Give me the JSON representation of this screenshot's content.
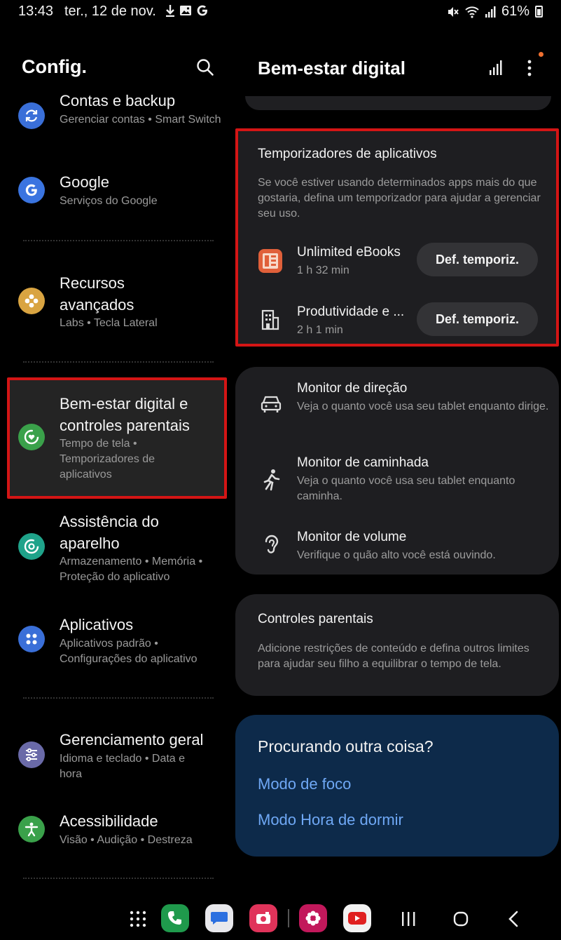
{
  "status": {
    "time": "13:43",
    "date": "ter., 12 de nov.",
    "notif_icons": [
      "download-icon",
      "image-icon",
      "google-icon"
    ],
    "battery": "61%"
  },
  "left": {
    "title": "Config.",
    "items": [
      {
        "title": "Contas e backup",
        "subtitle": "Gerenciar contas • Smart Switch",
        "icon": "sync-icon",
        "color": "#3a6fd8"
      },
      {
        "title": "Google",
        "subtitle": "Serviços do Google",
        "icon": "google-g-icon",
        "color": "#3a74e0"
      },
      {
        "title": "Recursos avançados",
        "subtitle": "Labs • Tecla Lateral",
        "icon": "gear-flower-icon",
        "color": "#d9a441"
      },
      {
        "title": "Bem-estar digital e controles parentais",
        "subtitle": "Tempo de tela • Temporizadores de aplicativos",
        "icon": "heart-ring-icon",
        "color": "#3aa14a"
      },
      {
        "title": "Assistência do aparelho",
        "subtitle": "Armazenamento • Memória • Proteção do aplicativo",
        "icon": "care-ring-icon",
        "color": "#1fa38a"
      },
      {
        "title": "Aplicativos",
        "subtitle": "Aplicativos padrão • Configurações do aplicativo",
        "icon": "apps-grid-icon",
        "color": "#3a6fd8"
      },
      {
        "title": "Gerenciamento geral",
        "subtitle": "Idioma e teclado • Data e hora",
        "icon": "sliders-icon",
        "color": "#6a6aa8"
      },
      {
        "title": "Acessibilidade",
        "subtitle": "Visão • Audição • Destreza",
        "icon": "accessibility-icon",
        "color": "#3aa14a"
      }
    ]
  },
  "right": {
    "title": "Bem-estar digital",
    "timers": {
      "title": "Temporizadores de aplicativos",
      "desc": "Se você estiver usando determinados apps mais do que gostaria, defina um temporizador para ajudar a gerenciar seu uso.",
      "apps": [
        {
          "name": "Unlimited eBooks",
          "time": "1 h 32 min",
          "button": "Def. temporiz."
        },
        {
          "name": "Produtividade e ...",
          "time": "2 h 1 min",
          "button": "Def. temporiz."
        }
      ]
    },
    "monitors": [
      {
        "name": "Monitor de direção",
        "desc": "Veja o quanto você usa seu tablet enquanto dirige."
      },
      {
        "name": "Monitor de caminhada",
        "desc": "Veja o quanto você usa seu tablet enquanto caminha."
      },
      {
        "name": "Monitor de volume",
        "desc": "Verifique o quão alto você está ouvindo."
      }
    ],
    "parental": {
      "title": "Controles parentais",
      "desc": "Adicione restrições de conteúdo e defina outros limites para ajudar seu filho a equilibrar o tempo de tela."
    },
    "lookup": {
      "title": "Procurando outra coisa?",
      "links": [
        "Modo de foco",
        "Modo Hora de dormir"
      ]
    }
  },
  "nav": {
    "apps": [
      "apps-drawer-icon",
      "phone-icon",
      "messages-icon",
      "camera-icon",
      "gallery-icon",
      "youtube-icon"
    ],
    "buttons": [
      "recents-icon",
      "home-icon",
      "back-icon"
    ]
  }
}
